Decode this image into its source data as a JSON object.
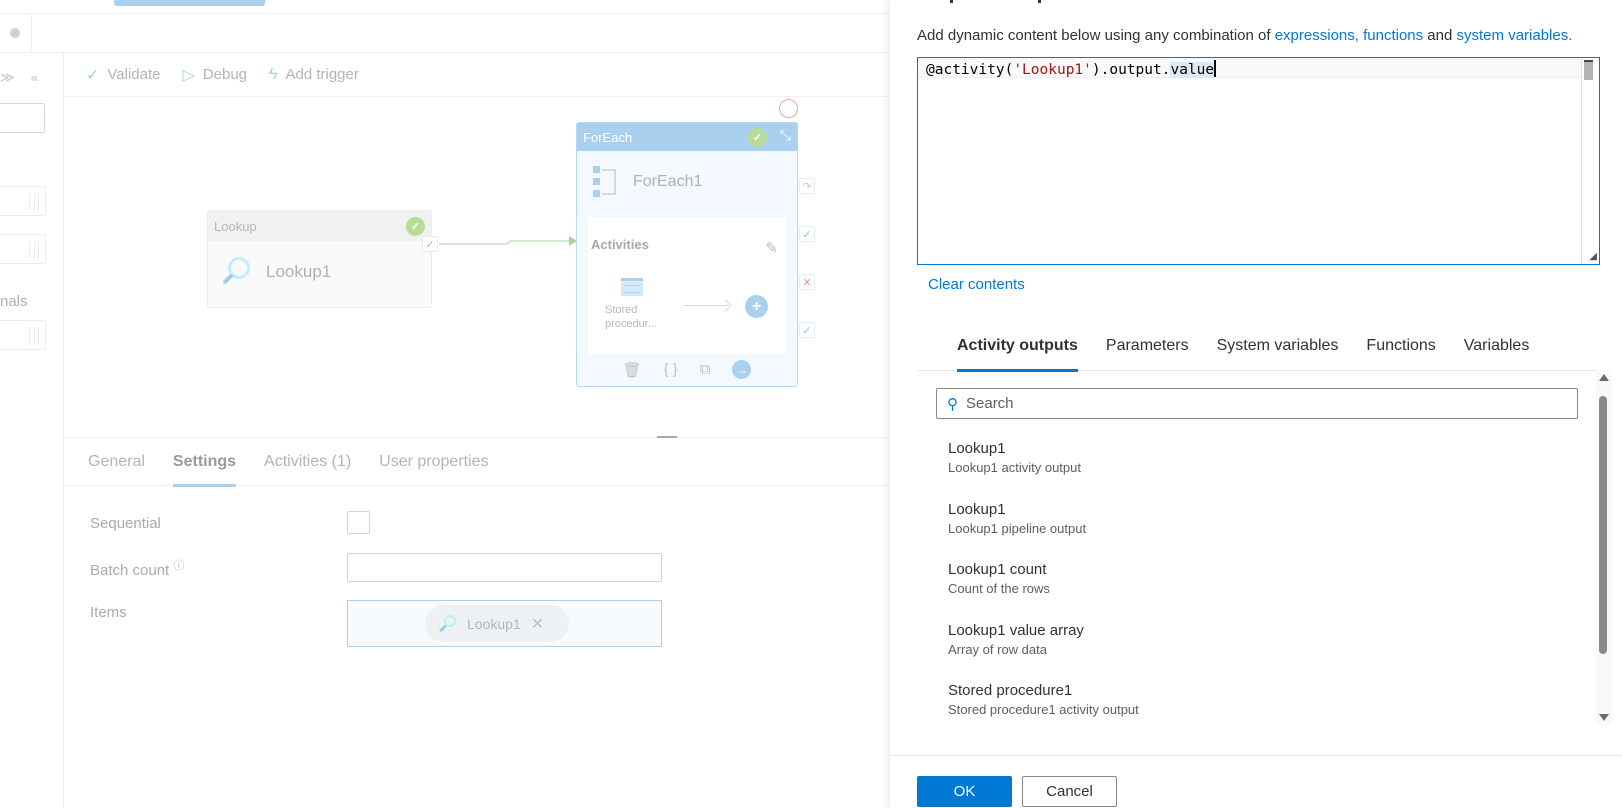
{
  "toolbar": {
    "validate": "Validate",
    "debug": "Debug",
    "add_trigger": "Add trigger"
  },
  "sidebar": {
    "partial_text": "nals",
    "collapse_icons": "≫ «"
  },
  "canvas": {
    "lookup_node": {
      "type_label": "Lookup",
      "name": "Lookup1",
      "status": "succeeded"
    },
    "foreach_node": {
      "type_label": "ForEach",
      "name": "ForEach1",
      "status": "succeeded",
      "activities_label": "Activities",
      "inner_activity_label": "Stored procedur..."
    }
  },
  "settings": {
    "tabs": [
      {
        "label": "General",
        "active": false
      },
      {
        "label": "Settings",
        "active": true
      },
      {
        "label": "Activities (1)",
        "active": false
      },
      {
        "label": "User properties",
        "active": false
      }
    ],
    "sequential_label": "Sequential",
    "sequential_checked": false,
    "batch_count_label": "Batch count",
    "batch_count_value": "",
    "items_label": "Items",
    "items_chip": "Lookup1"
  },
  "dialog": {
    "intro_text": "Add dynamic content below using any combination of ",
    "intro_link1": "expressions, functions",
    "intro_and": " and ",
    "intro_link2": "system variables.",
    "expression": {
      "prefix": "@activity(",
      "string": "'Lookup1'",
      "mid": ").output.",
      "selected": "value"
    },
    "clear_contents": "Clear contents",
    "tabs": [
      {
        "label": "Activity outputs",
        "active": true
      },
      {
        "label": "Parameters",
        "active": false
      },
      {
        "label": "System variables",
        "active": false
      },
      {
        "label": "Functions",
        "active": false
      },
      {
        "label": "Variables",
        "active": false
      }
    ],
    "search_placeholder": "Search",
    "items": [
      {
        "title": "Lookup1",
        "subtitle": "Lookup1 activity output"
      },
      {
        "title": "Lookup1",
        "subtitle": "Lookup1 pipeline output"
      },
      {
        "title": "Lookup1 count",
        "subtitle": "Count of the rows"
      },
      {
        "title": "Lookup1 value array",
        "subtitle": "Array of row data"
      },
      {
        "title": "Stored procedure1",
        "subtitle": "Stored procedure1 activity output"
      }
    ],
    "ok_label": "OK",
    "cancel_label": "Cancel"
  },
  "colors": {
    "accent": "#0078d4",
    "success": "#b9db9a",
    "node_header": "#a9d1ef"
  }
}
